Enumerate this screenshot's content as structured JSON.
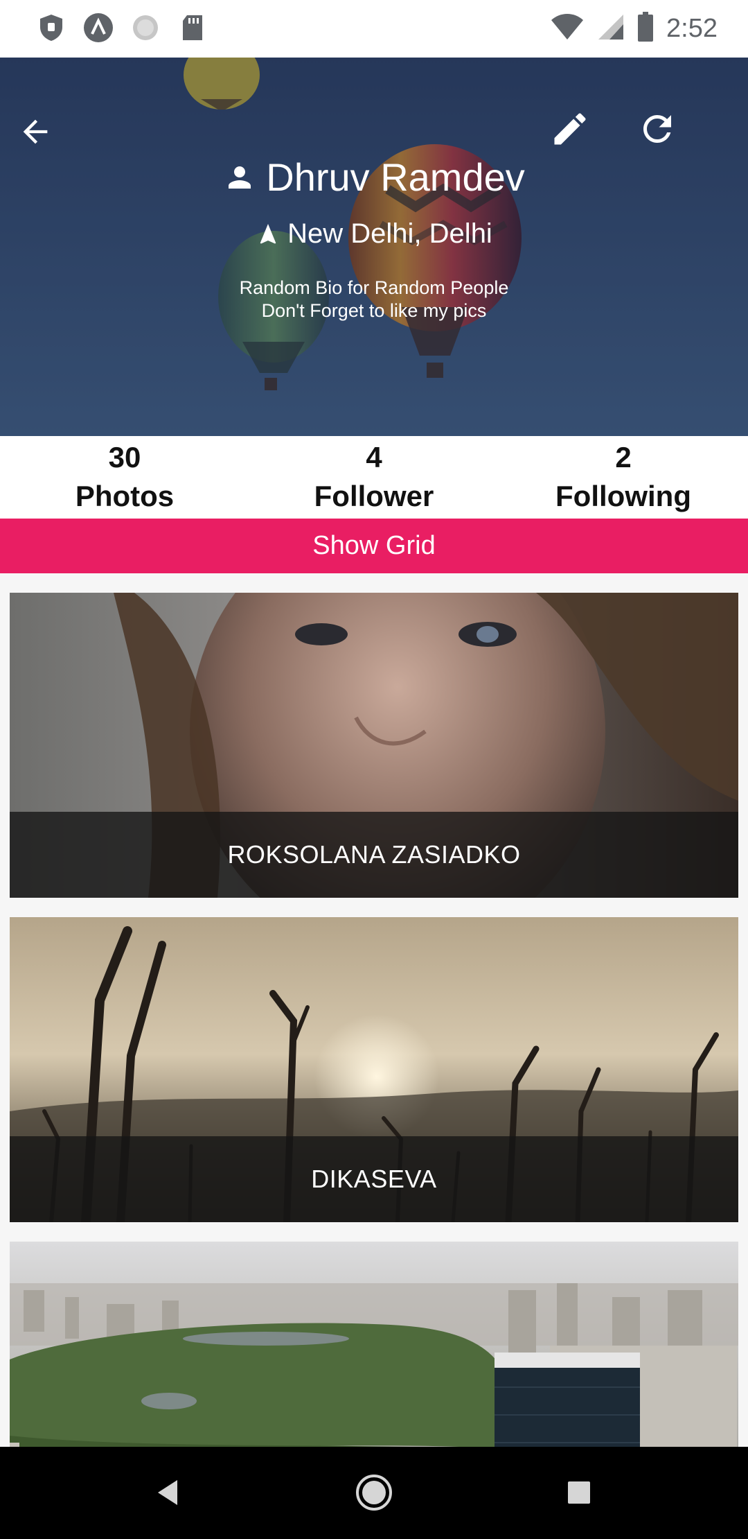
{
  "status_bar": {
    "time": "2:52",
    "icons": [
      "shield-icon",
      "app-icon",
      "circle-icon",
      "sd-card-icon",
      "wifi-icon",
      "signal-icon",
      "battery-icon"
    ]
  },
  "header": {
    "back_icon": "arrow-back-icon",
    "edit_icon": "pencil-icon",
    "refresh_icon": "refresh-icon",
    "name": "Dhruv Ramdev",
    "location": "New Delhi, Delhi",
    "bio_line1": "Random Bio for Random People",
    "bio_line2": "Don't Forget to like my pics"
  },
  "stats": [
    {
      "value": "30",
      "label": "Photos"
    },
    {
      "value": "4",
      "label": "Follower"
    },
    {
      "value": "2",
      "label": "Following"
    }
  ],
  "show_grid_label": "Show Grid",
  "feed": [
    {
      "caption": "ROKSOLANA ZASIADKO"
    },
    {
      "caption": "DIKASEVA"
    },
    {
      "caption": ""
    }
  ],
  "colors": {
    "accent": "#e91e63",
    "cover": "#304a6e",
    "navbar": "#000000"
  }
}
